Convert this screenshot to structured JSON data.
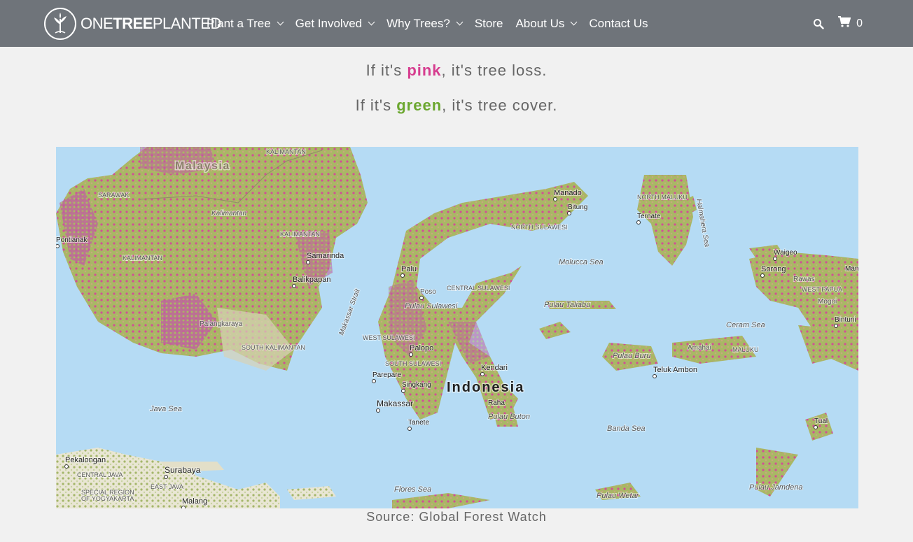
{
  "header": {
    "logo_text_light": "ONE",
    "logo_text_bold": "TREE",
    "logo_text_end": "PLANTED",
    "nav": [
      {
        "label": "Plant a Tree",
        "dropdown": true
      },
      {
        "label": "Get Involved",
        "dropdown": true
      },
      {
        "label": "Why Trees?",
        "dropdown": true
      },
      {
        "label": "Store",
        "dropdown": false
      },
      {
        "label": "About Us",
        "dropdown": true
      },
      {
        "label": "Contact Us",
        "dropdown": false
      }
    ],
    "cart_count": "0"
  },
  "intro": {
    "line1_pre": "If it's ",
    "line1_word": "pink",
    "line1_post": ", it's tree loss.",
    "line2_pre": "If it's ",
    "line2_word": "green",
    "line2_post": ", it's tree cover."
  },
  "map": {
    "labels": [
      {
        "id": "malaysia",
        "text": "Malaysia"
      },
      {
        "id": "kalimantan-top",
        "text": "KALIMANTAN"
      },
      {
        "id": "sarawak",
        "text": "SARAWAK"
      },
      {
        "id": "kalimantan",
        "text": "Kalimantan"
      },
      {
        "id": "pontianak",
        "text": "Pontianak"
      },
      {
        "id": "west-kalimantan",
        "text": "KALIMANTAN"
      },
      {
        "id": "east-kalimantan",
        "text": "KALIMANTAN"
      },
      {
        "id": "samarinda",
        "text": "Samarinda"
      },
      {
        "id": "balikpapan",
        "text": "Balikpapan"
      },
      {
        "id": "palangkaraya",
        "text": "Palangkaraya"
      },
      {
        "id": "south-kalimantan",
        "text": "SOUTH KALIMANTAN"
      },
      {
        "id": "makassar-strait",
        "text": "Makassar Strait"
      },
      {
        "id": "manado",
        "text": "Manado"
      },
      {
        "id": "bitung",
        "text": "Bitung"
      },
      {
        "id": "north-sulawesi",
        "text": "NORTH SULAWESI"
      },
      {
        "id": "palu",
        "text": "Palu"
      },
      {
        "id": "poso",
        "text": "Poso"
      },
      {
        "id": "central-sulawesi",
        "text": "CENTRAL SULAWESI"
      },
      {
        "id": "pulau-sulawesi",
        "text": "Pulau Sulawesi"
      },
      {
        "id": "west-sulawesi",
        "text": "WEST SULAWESI"
      },
      {
        "id": "palopo",
        "text": "Palopo"
      },
      {
        "id": "south-sulawesi",
        "text": "SOUTH SULAWESI"
      },
      {
        "id": "parepare",
        "text": "Parepare"
      },
      {
        "id": "singkang",
        "text": "Singkang"
      },
      {
        "id": "kendari",
        "text": "Kendari"
      },
      {
        "id": "indonesia",
        "text": "Indonesia"
      },
      {
        "id": "makassar",
        "text": "Makassar"
      },
      {
        "id": "tanete",
        "text": "Tanete"
      },
      {
        "id": "raha",
        "text": "Raha"
      },
      {
        "id": "pulau-buton",
        "text": "Pulau Buton"
      },
      {
        "id": "molucca-sea",
        "text": "Molucca Sea"
      },
      {
        "id": "pulau-taliabu",
        "text": "Pulau Taliabu"
      },
      {
        "id": "north-maluku",
        "text": "NORTH MALUKU"
      },
      {
        "id": "ternate",
        "text": "Ternate"
      },
      {
        "id": "halmahera-sea",
        "text": "Halmahera Sea"
      },
      {
        "id": "waigeo",
        "text": "Waigeo"
      },
      {
        "id": "sorong",
        "text": "Sorong"
      },
      {
        "id": "rawas",
        "text": "Rawas"
      },
      {
        "id": "west-papua",
        "text": "WEST PAPUA"
      },
      {
        "id": "mogoi",
        "text": "Mogoi"
      },
      {
        "id": "bintuni",
        "text": "Bintuni"
      },
      {
        "id": "ceram-sea",
        "text": "Ceram Sea"
      },
      {
        "id": "pulau-buru",
        "text": "Pulau Buru"
      },
      {
        "id": "amahai",
        "text": "Amahai"
      },
      {
        "id": "maluku",
        "text": "MALUKU"
      },
      {
        "id": "teluk-ambon",
        "text": "Teluk Ambon"
      },
      {
        "id": "banda-sea",
        "text": "Banda Sea"
      },
      {
        "id": "tual",
        "text": "Tual"
      },
      {
        "id": "java-sea",
        "text": "Java Sea"
      },
      {
        "id": "pekalongan",
        "text": "Pekalongan"
      },
      {
        "id": "central-java",
        "text": "CENTRAL JAVA"
      },
      {
        "id": "surabaya",
        "text": "Surabaya"
      },
      {
        "id": "east-java",
        "text": "EAST JAVA"
      },
      {
        "id": "special-region",
        "text": "SPECIAL REGION"
      },
      {
        "id": "of-yogyakarta",
        "text": "OF YOGYAKARTA"
      },
      {
        "id": "malang",
        "text": "Malang"
      },
      {
        "id": "flores-sea",
        "text": "Flores Sea"
      },
      {
        "id": "pulau-wetar",
        "text": "Pulau Wetar"
      },
      {
        "id": "pulau-jamdena",
        "text": "Pulau Jamdena"
      },
      {
        "id": "man",
        "text": "Man"
      }
    ]
  },
  "caption": "Source: Global Forest Watch",
  "colors": {
    "navbar": "#6f747a",
    "page_bg": "#f1f1f1",
    "pink": "#d63d8f",
    "green": "#6ba72f",
    "sea": "#b5dbf4",
    "land_green": "#a6b864"
  }
}
